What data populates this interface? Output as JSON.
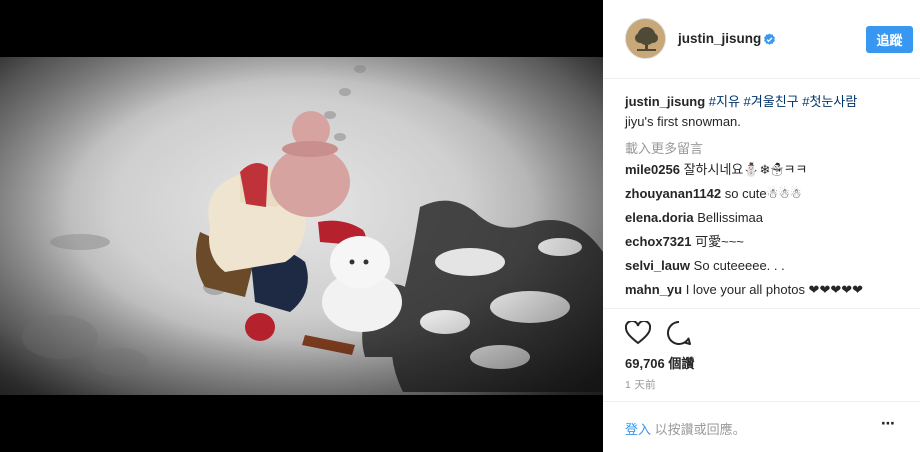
{
  "post": {
    "username": "justin_jisung",
    "follow_label": "追蹤",
    "caption_hashtags": "#지유 #겨울친구 #첫눈사람",
    "caption_text": "jiyu's first snowman.",
    "load_more_label": "載入更多留言",
    "comments": [
      {
        "user": "mile0256",
        "text": "잘하시네요⛄❄☃ㅋㅋ"
      },
      {
        "user": "zhouyanan1142",
        "text": "so cute☃☃☃"
      },
      {
        "user": "elena.doria",
        "text": "Bellissimaa"
      },
      {
        "user": "echox7321",
        "text": "可愛~~~"
      },
      {
        "user": "selvi_lauw",
        "text": "So cuteeeee. . ."
      },
      {
        "user": "mahn_yu",
        "text": "I love your all photos ❤❤❤❤❤"
      }
    ],
    "likes": "69,706 個讚",
    "time": "1 天前",
    "login_link": "登入",
    "login_rest": "以按讚或回應。",
    "more_label": "⋯",
    "verified_color": "#3897f0",
    "accent_color": "#3897f0"
  },
  "icons": {
    "verified": "verified-badge-icon",
    "heart": "heart-icon",
    "comment": "comment-bubble-icon",
    "more": "more-options-icon"
  }
}
